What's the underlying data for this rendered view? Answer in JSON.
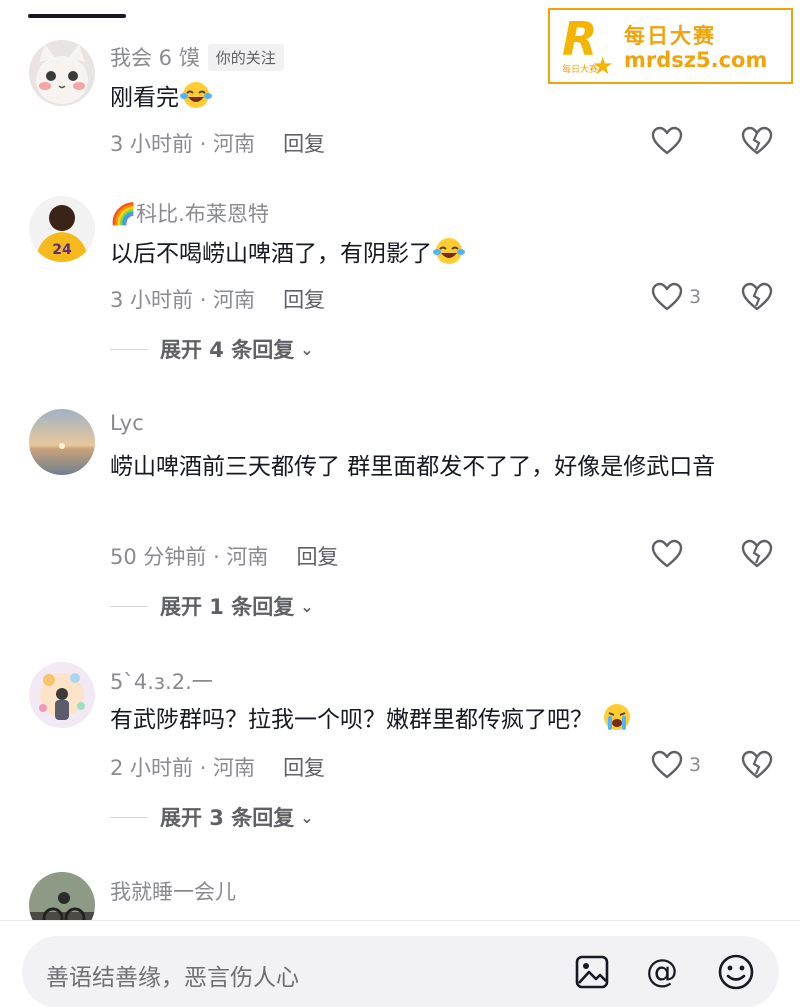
{
  "watermark": {
    "brand_cn": "每日大赛",
    "url": "mrdsz5.com",
    "logo_letter": "R",
    "logo_small": "每日大赛"
  },
  "comments": [
    {
      "user": "我会 6 馍",
      "badge": "你的关注",
      "text": "刚看完",
      "time": "3 小时前 · 河南",
      "reply": "回复",
      "likes": "",
      "emoji": "laughing-tears"
    },
    {
      "user": "🌈科比.布莱恩特",
      "text": "以后不喝崂山啤酒了，有阴影了",
      "time": "3 小时前 · 河南",
      "reply": "回复",
      "likes": "3",
      "expand": "展开 4 条回复",
      "emoji": "laughing-tears"
    },
    {
      "user": "Lyc",
      "text": "崂山啤酒前三天都传了 群里面都发不了了，好像是修武口音",
      "time": "50 分钟前 · 河南",
      "reply": "回复",
      "likes": "",
      "expand": "展开 1 条回复"
    },
    {
      "user": "5`4.ɜ.2.一",
      "text": "有武陟群吗？拉我一个呗？嫩群里都传疯了吧？",
      "time": "2 小时前 · 河南",
      "reply": "回复",
      "likes": "3",
      "expand": "展开 3 条回复",
      "emoji": "crying"
    },
    {
      "user": "我就睡一会儿"
    }
  ],
  "input": {
    "placeholder": "善语结善缘，恶言伤人心"
  },
  "colors": {
    "accent": "#f0a30a",
    "primary_text": "#161823",
    "secondary_text": "#8a8b91"
  }
}
